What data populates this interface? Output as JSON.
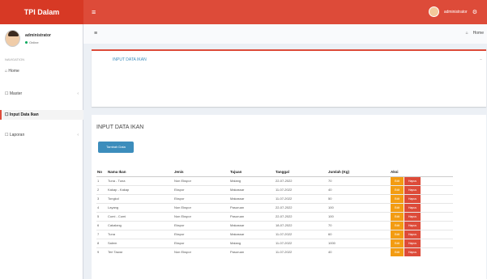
{
  "app": {
    "logo": "TPI Dalam"
  },
  "topbar": {
    "hamburger_glyph": "≡",
    "user_name": "administrator",
    "gear_glyph": "⚙"
  },
  "sidebar": {
    "profile_name": "administrator",
    "profile_status": "Online",
    "nav_header": "NAVIGATION",
    "items": [
      {
        "label": "Home",
        "icon": "home-icon"
      },
      {
        "label": "Master",
        "icon": "folder-icon"
      },
      {
        "label": "Input Data Ikan",
        "icon": "edit-icon"
      },
      {
        "label": "Laporan",
        "icon": "file-icon"
      }
    ]
  },
  "subbar": {
    "menu_glyph": "≡",
    "right_a": "⌂",
    "right_b": "Home"
  },
  "card1": {
    "title": "INPUT DATA IKAN",
    "tool": "−"
  },
  "card2": {
    "title": "INPUT DATA IKAN",
    "add_button": "Tambah Data"
  },
  "table": {
    "headers": [
      "No",
      "Nama Ikan",
      "Jenis",
      "Tujuan",
      "Tanggal",
      "Jumlah (Kg)",
      "Aksi"
    ],
    "edit_label": "Edit",
    "delete_label": "Hapus",
    "rows": [
      [
        "1",
        "Tuna - Tuna",
        "Non Ekspor",
        "Malang",
        "22-07-2022",
        "70"
      ],
      [
        "2",
        "Kakap - Kakap",
        "Ekspor",
        "Makassar",
        "11-07-2022",
        "40"
      ],
      [
        "3",
        "Tongkol",
        "Ekspor",
        "Makassar",
        "11-07-2022",
        "50"
      ],
      [
        "4",
        "Layang",
        "Non Ekspor",
        "Pasuruan",
        "22-07-2022",
        "100"
      ],
      [
        "5",
        "Cumi - Cumi",
        "Non Ekspor",
        "Pasuruan",
        "22-07-2022",
        "100"
      ],
      [
        "6",
        "Cakalang",
        "Ekspor",
        "Makassar",
        "18-07-2022",
        "70"
      ],
      [
        "7",
        "Tuna",
        "Ekspor",
        "Makassar",
        "11-07-2022",
        "60"
      ],
      [
        "8",
        "Salem",
        "Ekspor",
        "Malang",
        "11-07-2022",
        "1000"
      ],
      [
        "9",
        "Teri Tawar",
        "Non Ekspor",
        "Pasuruan",
        "11-07-2022",
        "40"
      ]
    ]
  }
}
